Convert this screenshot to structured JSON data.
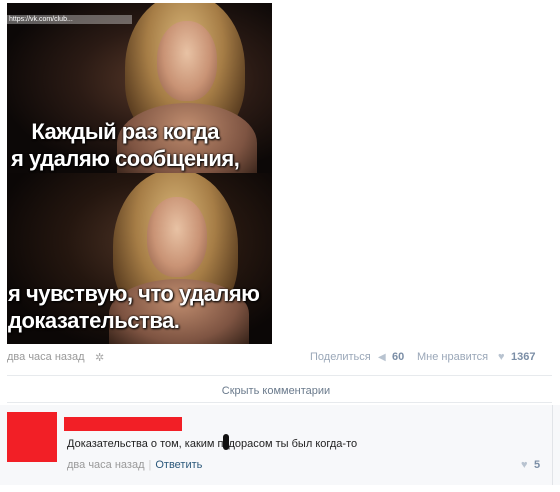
{
  "post": {
    "image": {
      "url_watermark": "https://vk.com/club...",
      "caption_top": "Каждый раз когда\nя удаляю сообщения,",
      "caption_top_line1": "Каждый раз когда",
      "caption_top_line2": "я удаляю сообщения,",
      "caption_bottom_line1": "я чувствую, что удаляю",
      "caption_bottom_line2": "доказательства."
    },
    "time": "два часа назад",
    "gear_icon": "gear-icon",
    "share_label": "Поделиться",
    "share_icon": "megaphone-icon",
    "share_count": "60",
    "like_label": "Мне нравится",
    "like_icon": "heart-icon",
    "like_count": "1367",
    "hide_comments_label": "Скрыть комментарии"
  },
  "comment": {
    "text_before": "Доказательства о том, каким п",
    "text_after": "дорасом ты был когда-то",
    "time": "два часа назад",
    "reply_label": "Ответить",
    "like_count": "5",
    "avatar_color": "#f21f26"
  }
}
